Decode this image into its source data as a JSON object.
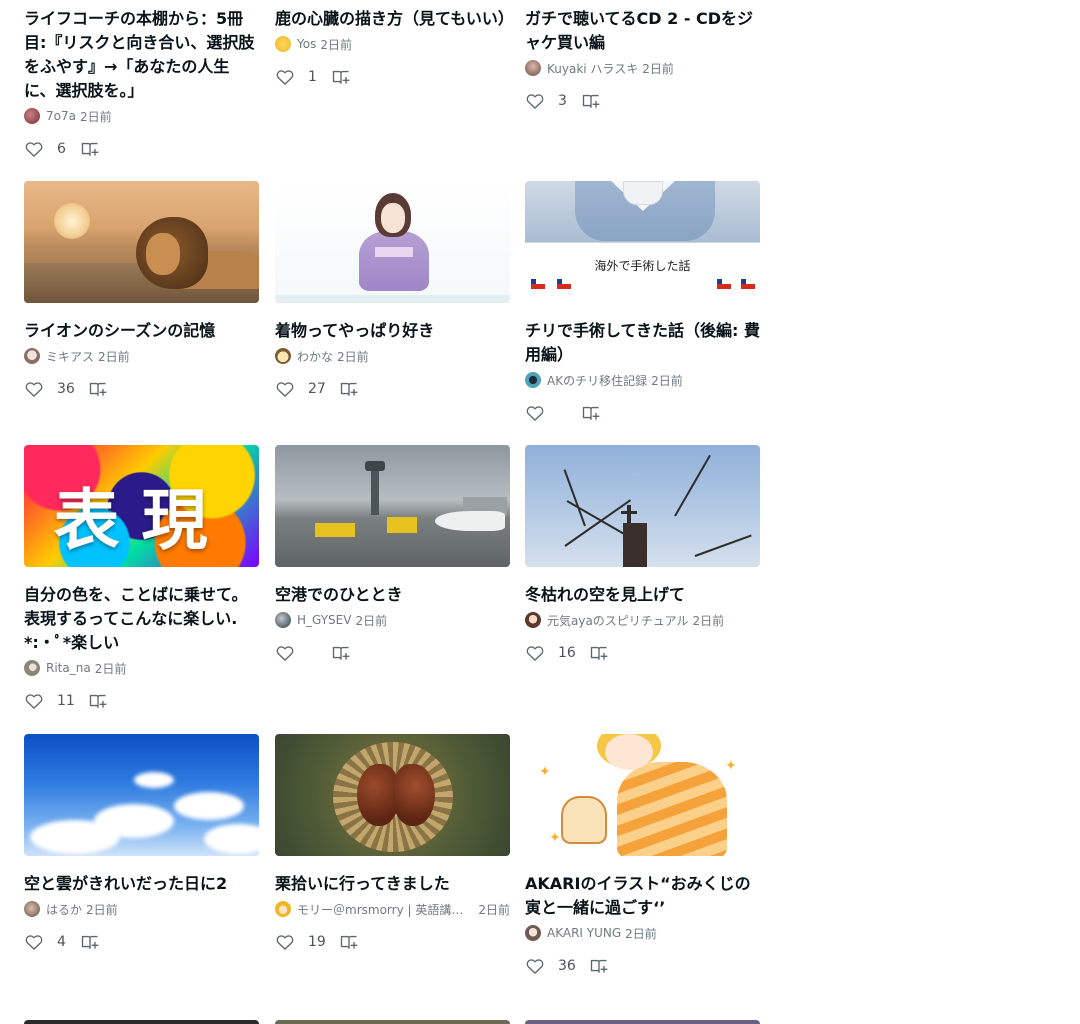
{
  "icons": {
    "like": "heart-outline-icon",
    "save": "magazine-add-icon"
  },
  "colors": {
    "text": "#08131a",
    "meta": "#6e7a82",
    "count": "#4a555c",
    "icon": "#5c666d"
  },
  "cards": [
    {
      "title": "ライフコーチの本棚から：5冊目:『リスクと向き合い、選択肢をふやす』→「あなたの人生に、選択肢を。」",
      "author": "7o7a",
      "time": "2日前",
      "likes": "6"
    },
    {
      "title": "鹿の心臓の描き方（見てもいい）",
      "author": "Yos",
      "time": "2日前",
      "likes": "1"
    },
    {
      "title": "ガチで聴いてるCD 2 - CDをジャケ買い編",
      "author": "Kuyaki ハラスキ",
      "time": "2日前",
      "likes": "3"
    },
    {
      "title": "ライオンのシーズンの記憶",
      "author": "ミキアス",
      "time": "2日前",
      "likes": "36"
    },
    {
      "title": "着物ってやっぱり好き",
      "author": "わかな",
      "time": "2日前",
      "likes": "27"
    },
    {
      "title": "チリで手術してきた話（後編: 費用編）",
      "author": "AKのチリ移住記録",
      "time": "2日前",
      "likes": "",
      "image_text": "海外で手術した話"
    },
    {
      "title": "自分の色を、ことばに乗せて。表現するってこんなに楽しい.*:・ﾟ*楽しい",
      "author": "Rita_na",
      "time": "2日前",
      "likes": "11",
      "image_text": "表現"
    },
    {
      "title": "空港でのひととき",
      "author": "H_GYSEV",
      "time": "2日前",
      "likes": ""
    },
    {
      "title": "冬枯れの空を見上げて",
      "author": "元気ayaのスピリチュアル",
      "time": "2日前",
      "likes": "16"
    },
    {
      "title": "空と雲がきれいだった日に2",
      "author": "はるか",
      "time": "2日前",
      "likes": "4"
    },
    {
      "title": "栗拾いに行ってきました",
      "author": "モリー＠mrsmorry | 英語講師NZ | 国際結婚",
      "time": "2日前",
      "likes": "19"
    },
    {
      "title": "AKARIのイラスト“おみくじの寅と一緒に過ごす‘’",
      "author": "AKARI YUNG",
      "time": "2日前",
      "likes": "36"
    }
  ]
}
